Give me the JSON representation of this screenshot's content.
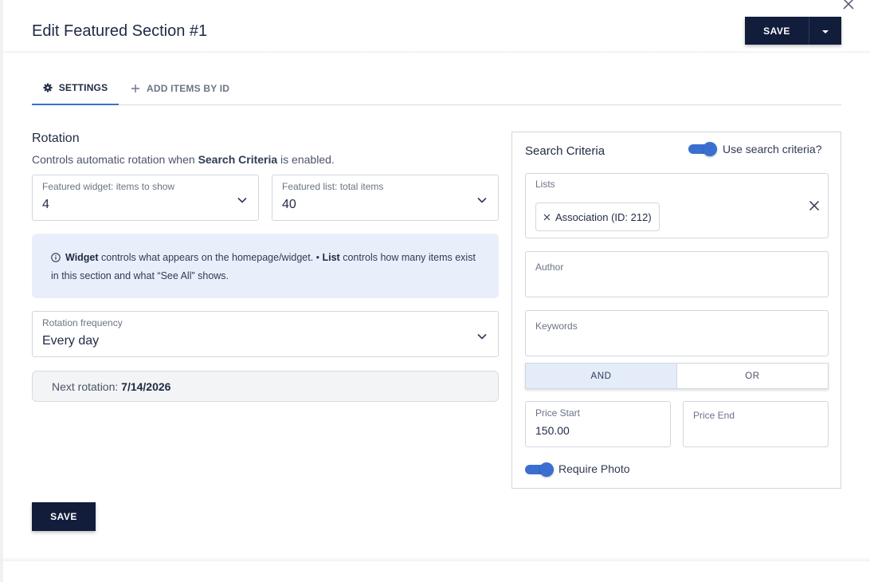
{
  "header": {
    "title": "Edit Featured Section #1",
    "save_label": "SAVE"
  },
  "tabs": [
    {
      "label": "SETTINGS",
      "icon": "gear-icon",
      "active": true
    },
    {
      "label": "ADD ITEMS BY ID",
      "icon": "plus-icon",
      "active": false
    }
  ],
  "rotation": {
    "title": "Rotation",
    "desc_prefix": "Controls automatic rotation when ",
    "desc_bold": "Search Criteria",
    "desc_suffix": " is enabled.",
    "widget_items": {
      "label": "Featured widget: items to show",
      "value": "4"
    },
    "list_items": {
      "label": "Featured list: total items",
      "value": "40"
    },
    "info": {
      "bold1": "Widget",
      "text1": " controls what appears on the homepage/widget.  •  ",
      "bold2": "List",
      "text2": " controls how many items exist in this section and what “See All” shows."
    },
    "frequency": {
      "label": "Rotation frequency",
      "value": "Every day"
    },
    "next_rotation_label": "Next rotation: ",
    "next_rotation_date": "7/14/2026"
  },
  "search_criteria": {
    "title": "Search Criteria",
    "use_label": "Use search criteria?",
    "use_enabled": true,
    "lists_label": "Lists",
    "lists_chip": "Association (ID: 212)",
    "author_label": "Author",
    "keywords_label": "Keywords",
    "and_label": "AND",
    "or_label": "OR",
    "selected_operator": "AND",
    "price_start_label": "Price Start",
    "price_start_value": "150.00",
    "price_end_label": "Price End",
    "require_photo_label": "Require Photo",
    "require_photo_enabled": true
  },
  "footer": {
    "save_label": "SAVE"
  },
  "colors": {
    "primary": "#121d3b",
    "accent": "#3a6fd1",
    "info_bg": "#e9effa"
  }
}
